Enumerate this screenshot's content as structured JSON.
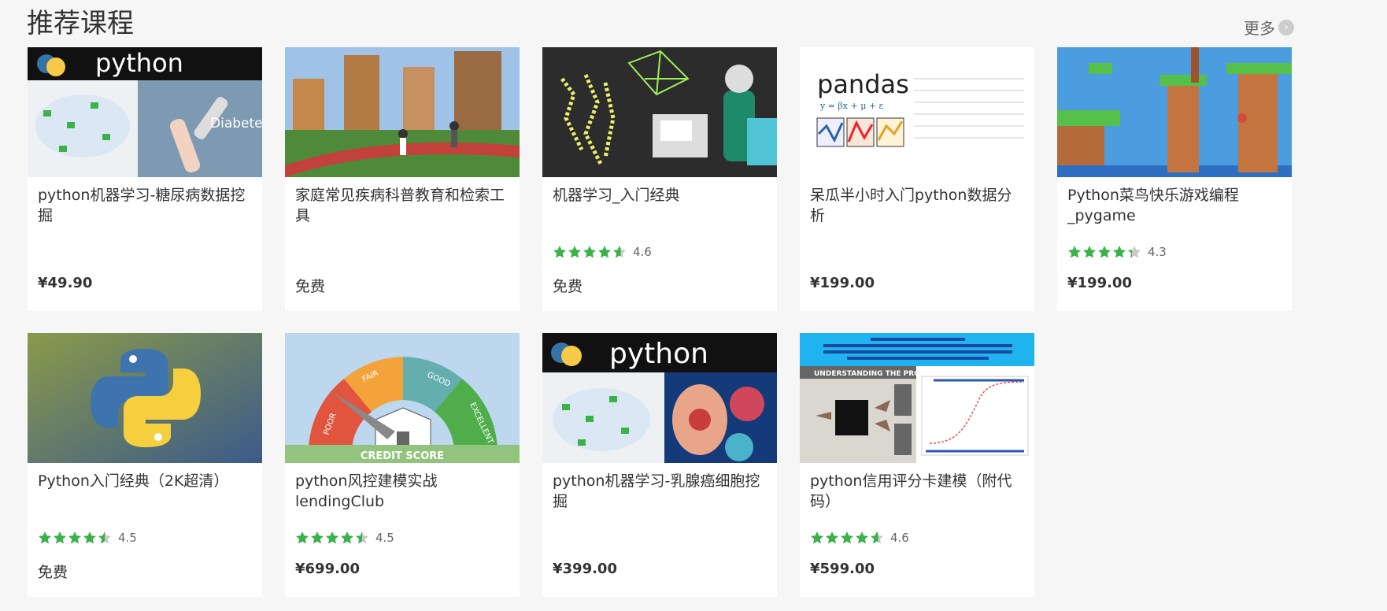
{
  "section": {
    "title": "推荐课程",
    "more_label": "更多",
    "more_icon": "chevron-right-icon"
  },
  "colors": {
    "star_green": "#3bb149",
    "star_gray": "#c8c8c8",
    "page_bg": "#f6f6f6",
    "card_bg": "#ffffff"
  },
  "courses": [
    {
      "title": "python机器学习-糖尿病数据挖掘",
      "price": "¥49.90",
      "free": false,
      "rating": null,
      "thumb": "python-diabetes",
      "thumb_text": [
        "python",
        "Diabetes"
      ]
    },
    {
      "title": "家庭常见疾病科普教育和检索工具",
      "price": "免费",
      "free": true,
      "rating": null,
      "thumb": "city-park",
      "thumb_text": []
    },
    {
      "title": "机器学习_入门经典",
      "price": "免费",
      "free": true,
      "rating": "4.6",
      "rating_value": 4.6,
      "thumb": "robot-ml",
      "thumb_text": []
    },
    {
      "title": "呆瓜半小时入门python数据分析",
      "price": "¥199.00",
      "free": false,
      "rating": null,
      "thumb": "pandas",
      "thumb_text": [
        "pandas"
      ]
    },
    {
      "title": "Python菜鸟快乐游戏编程_pygame",
      "price": "¥199.00",
      "free": false,
      "rating": "4.3",
      "rating_value": 4.3,
      "thumb": "pixel-game",
      "thumb_text": []
    },
    {
      "title": "Python入门经典（2K超清）",
      "price": "免费",
      "free": true,
      "rating": "4.5",
      "rating_value": 4.5,
      "thumb": "python-logo",
      "thumb_text": []
    },
    {
      "title": "python风控建模实战lendingClub",
      "price": "¥699.00",
      "free": false,
      "rating": "4.5",
      "rating_value": 4.5,
      "thumb": "credit-score",
      "thumb_text": [
        "POOR",
        "FAIR",
        "GOOD",
        "EXCELLENT",
        "CREDIT SCORE"
      ]
    },
    {
      "title": "python机器学习-乳腺癌细胞挖掘",
      "price": "¥399.00",
      "free": false,
      "rating": null,
      "thumb": "python-cancer",
      "thumb_text": [
        "python"
      ]
    },
    {
      "title": "python信用评分卡建模（附代码）",
      "price": "¥599.00",
      "free": false,
      "rating": "4.6",
      "rating_value": 4.6,
      "thumb": "credit-model",
      "thumb_text": [
        "UNDERSTANDING THE PROCESS"
      ]
    }
  ]
}
